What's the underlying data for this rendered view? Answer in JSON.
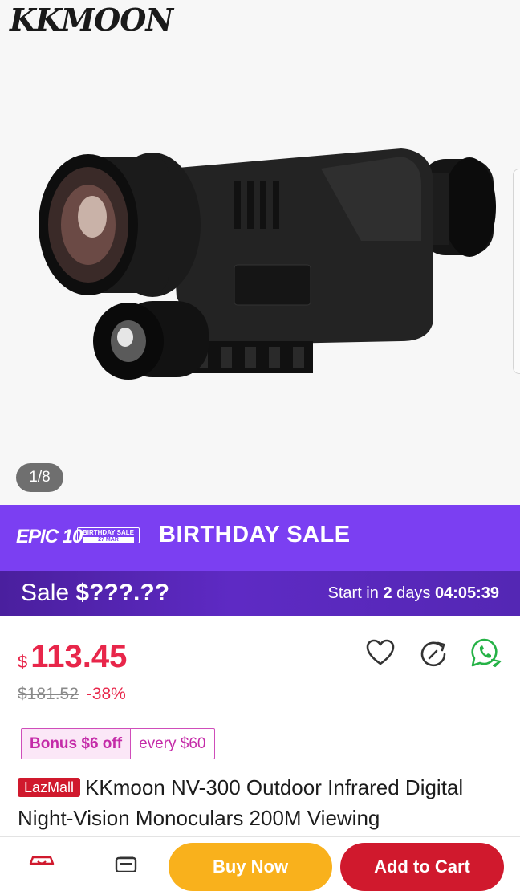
{
  "gallery": {
    "brand": "KKMOON",
    "counter": "1/8"
  },
  "banner": {
    "epic": "EPIC 10",
    "badge_top": "BIRTHDAY SALE",
    "badge_date": "27 MAR",
    "title": "BIRTHDAY SALE",
    "sale_prefix": "Sale",
    "sale_amount": "$???.??",
    "countdown_prefix": "Start in",
    "countdown_days": "2",
    "countdown_days_label": "days",
    "countdown_time": "04:05:39"
  },
  "pricing": {
    "currency": "$",
    "price": "113.45",
    "original": "$181.52",
    "discount": "-38%"
  },
  "bonus": {
    "label": "Bonus $6 off",
    "condition": "every $60"
  },
  "product": {
    "badge": "LazMall",
    "title": "KKmoon NV-300 Outdoor Infrared Digital Night-Vision Monoculars 200M Viewing"
  },
  "actions": {
    "buy_now": "Buy Now",
    "add_to_cart": "Add to Cart"
  },
  "colors": {
    "price_red": "#e8264a",
    "banner_purple": "#7b3ff2",
    "buy_now": "#f9b11c",
    "add_to_cart": "#d0192d",
    "whatsapp_green": "#25b246"
  },
  "icons": [
    "heart-icon",
    "share-icon",
    "whatsapp-icon",
    "store-icon",
    "chat-icon"
  ]
}
